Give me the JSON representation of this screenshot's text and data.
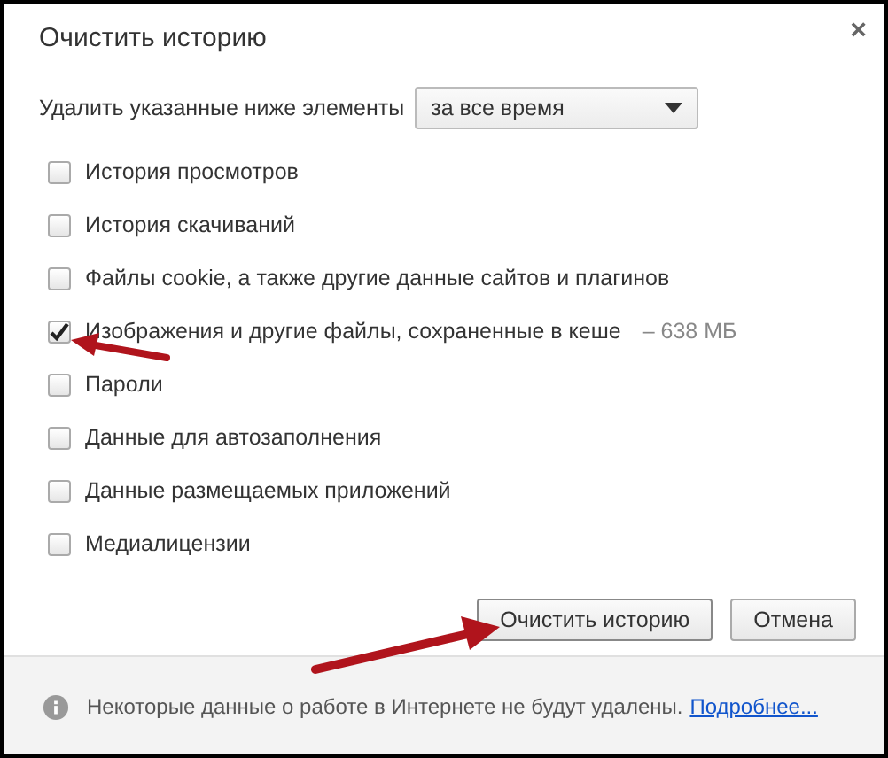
{
  "dialog": {
    "title": "Очистить историю",
    "close": "×"
  },
  "range": {
    "label": "Удалить указанные ниже элементы",
    "value": "за все время"
  },
  "items": [
    {
      "label": "История просмотров",
      "checked": false
    },
    {
      "label": "История скачиваний",
      "checked": false
    },
    {
      "label": "Файлы cookie, а также другие данные сайтов и плагинов",
      "checked": false
    },
    {
      "label": "Изображения и другие файлы, сохраненные в кеше",
      "note": "–  638 МБ",
      "checked": true
    },
    {
      "label": "Пароли",
      "checked": false
    },
    {
      "label": "Данные для автозаполнения",
      "checked": false
    },
    {
      "label": "Данные размещаемых приложений",
      "checked": false
    },
    {
      "label": "Медиалицензии",
      "checked": false
    }
  ],
  "buttons": [
    {
      "label": "Очистить историю",
      "kind": "primary"
    },
    {
      "label": "Отмена",
      "kind": "secondary"
    }
  ],
  "footer": {
    "text": "Некоторые данные о работе в Интернете не будут удалены.",
    "link": "Подробнее..."
  }
}
